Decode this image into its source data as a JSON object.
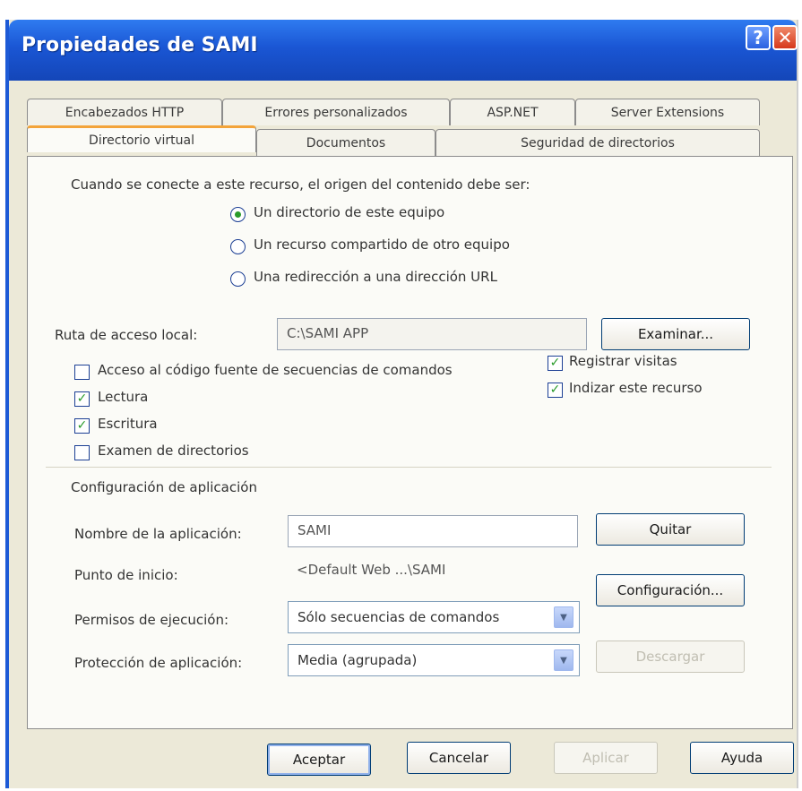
{
  "window": {
    "title": "Propiedades de SAMI",
    "help_glyph": "?",
    "close_glyph": "✕"
  },
  "tabs": {
    "row_top": [
      "Encabezados HTTP",
      "Errores personalizados",
      "ASP.NET",
      "Server Extensions"
    ],
    "row_bottom": [
      "Directorio virtual",
      "Documentos",
      "Seguridad de directorios"
    ],
    "active": "Directorio virtual"
  },
  "source": {
    "prompt": "Cuando se conecte a este recurso, el origen del contenido debe ser:",
    "options": [
      "Un directorio de este equipo",
      "Un recurso compartido de otro equipo",
      "Una redirección a una dirección URL"
    ],
    "selected": "Un directorio de este equipo"
  },
  "local_path": {
    "label": "Ruta de acceso local:",
    "value": "C:\\SAMI APP",
    "browse_label": "Examinar..."
  },
  "permissions": {
    "script_source": {
      "label": "Acceso al código fuente de secuencias de comandos",
      "checked": false
    },
    "read": {
      "label": "Lectura",
      "checked": true
    },
    "write": {
      "label": "Escritura",
      "checked": true
    },
    "browse": {
      "label": "Examen de directorios",
      "checked": false
    },
    "log_visits": {
      "label": "Registrar visitas",
      "checked": true
    },
    "index": {
      "label": "Indizar este recurso",
      "checked": true
    },
    "check_glyph": "✓"
  },
  "app_config": {
    "heading": "Configuración de aplicación",
    "name_label": "Nombre de la aplicación:",
    "name_value": "SAMI",
    "remove_label": "Quitar",
    "start_label": "Punto de inicio:",
    "start_value": "<Default Web ...\\SAMI",
    "config_label": "Configuración...",
    "exec_label": "Permisos de ejecución:",
    "exec_value": "Sólo secuencias de comandos",
    "protection_label": "Protección de aplicación:",
    "protection_value": "Media (agrupada)",
    "unload_label": "Descargar",
    "arrow_glyph": "▼"
  },
  "footer": {
    "ok": "Aceptar",
    "cancel": "Cancelar",
    "apply": "Aplicar",
    "help": "Ayuda"
  }
}
